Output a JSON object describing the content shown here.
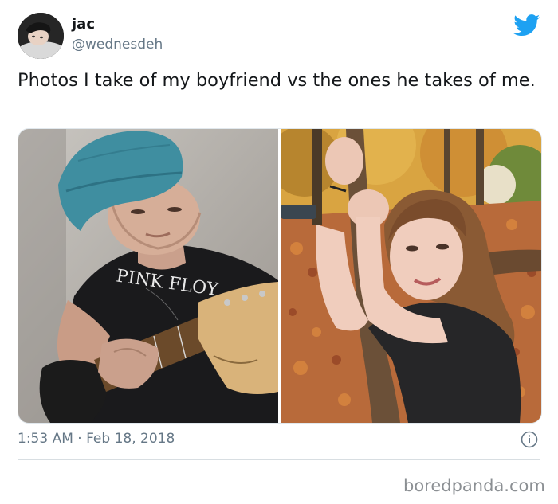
{
  "tweet": {
    "display_name": "jac",
    "handle": "@wednesdeh",
    "text": "Photos I take of my boyfriend vs the ones he takes of me.",
    "timestamp": "1:53 AM · Feb 18, 2018",
    "left_photo_shirt_text": "PINK FLOY"
  },
  "icons": {
    "brand": "twitter-bird-icon",
    "info": "info-icon"
  },
  "colors": {
    "twitter_blue": "#1da1f2",
    "secondary_text": "#657786"
  },
  "watermark": "boredpanda.com"
}
